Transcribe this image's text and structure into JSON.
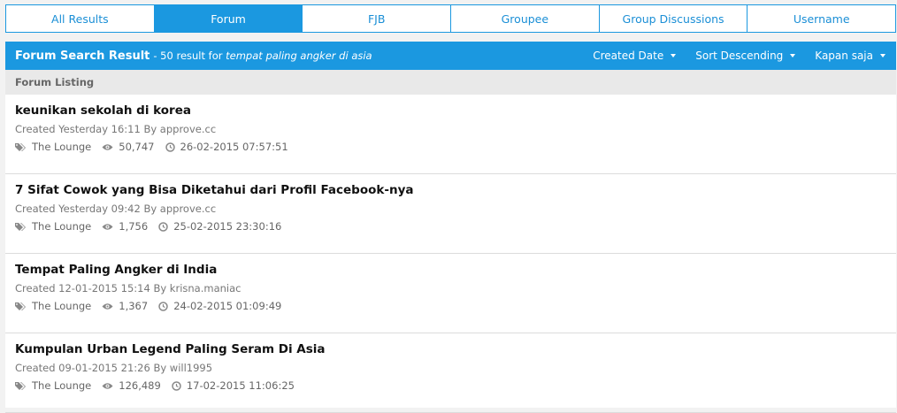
{
  "tabs": [
    {
      "label": "All Results",
      "active": false
    },
    {
      "label": "Forum",
      "active": true
    },
    {
      "label": "FJB",
      "active": false
    },
    {
      "label": "Groupee",
      "active": false
    },
    {
      "label": "Group Discussions",
      "active": false
    },
    {
      "label": "Username",
      "active": false
    }
  ],
  "header": {
    "title": "Forum Search Result",
    "sub_prefix": "- 50 result for",
    "query": "tempat paling angker di asia",
    "controls": [
      {
        "label": "Created Date"
      },
      {
        "label": "Sort Descending"
      },
      {
        "label": "Kapan saja"
      }
    ]
  },
  "listing_label": "Forum Listing",
  "items": [
    {
      "title": "keunikan sekolah di korea",
      "meta": "Created Yesterday 16:11 By approve.cc",
      "tag": "The Lounge",
      "views": "50,747",
      "last": "26-02-2015 07:57:51"
    },
    {
      "title": "7 Sifat Cowok yang Bisa Diketahui dari Profil Facebook-nya",
      "meta": "Created Yesterday 09:42 By approve.cc",
      "tag": "The Lounge",
      "views": "1,756",
      "last": "25-02-2015 23:30:16"
    },
    {
      "title": "Tempat Paling Angker di India",
      "meta": "Created 12-01-2015 15:14 By krisna.maniac",
      "tag": "The Lounge",
      "views": "1,367",
      "last": "24-02-2015 01:09:49"
    },
    {
      "title": "Kumpulan Urban Legend Paling Seram Di Asia",
      "meta": "Created 09-01-2015 21:26 By will1995",
      "tag": "The Lounge",
      "views": "126,489",
      "last": "17-02-2015 11:06:25"
    }
  ],
  "icons": {
    "tag": "tags-icon",
    "views": "eye-icon",
    "time": "clock-icon"
  },
  "colors": {
    "accent": "#1b98e0",
    "listing_bg": "#e9e9e9"
  }
}
